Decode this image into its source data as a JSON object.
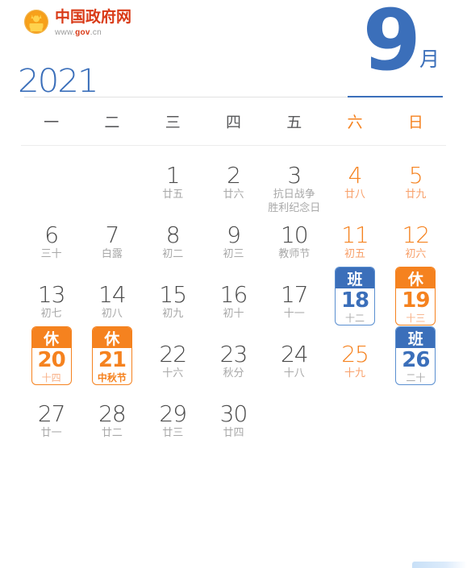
{
  "brand": {
    "emblem_icon": "national-emblem-icon",
    "site_name": "中国政府网",
    "url_prefix": "www.",
    "url_mid": "gov",
    "url_suffix": ".cn"
  },
  "header": {
    "year": "2021",
    "month_number": "9",
    "month_unit": "月",
    "accent_color": "#3b6fba",
    "weekend_color": "#f5821f"
  },
  "weekdays": [
    {
      "label": "一",
      "weekend": false
    },
    {
      "label": "二",
      "weekend": false
    },
    {
      "label": "三",
      "weekend": false
    },
    {
      "label": "四",
      "weekend": false
    },
    {
      "label": "五",
      "weekend": false
    },
    {
      "label": "六",
      "weekend": true
    },
    {
      "label": "日",
      "weekend": true
    }
  ],
  "calendar": {
    "leading_blanks": 2,
    "days": [
      {
        "day": "1",
        "lunar": "廿五",
        "weekend": false,
        "mark": null
      },
      {
        "day": "2",
        "lunar": "廿六",
        "weekend": false,
        "mark": null
      },
      {
        "day": "3",
        "lunar": "抗日战争\n胜利纪念日",
        "weekend": false,
        "mark": null
      },
      {
        "day": "4",
        "lunar": "廿八",
        "weekend": true,
        "mark": null
      },
      {
        "day": "5",
        "lunar": "廿九",
        "weekend": true,
        "mark": null
      },
      {
        "day": "6",
        "lunar": "三十",
        "weekend": false,
        "mark": null
      },
      {
        "day": "7",
        "lunar": "白露",
        "weekend": false,
        "mark": null
      },
      {
        "day": "8",
        "lunar": "初二",
        "weekend": false,
        "mark": null
      },
      {
        "day": "9",
        "lunar": "初三",
        "weekend": false,
        "mark": null
      },
      {
        "day": "10",
        "lunar": "教师节",
        "weekend": false,
        "mark": null
      },
      {
        "day": "11",
        "lunar": "初五",
        "weekend": true,
        "mark": null
      },
      {
        "day": "12",
        "lunar": "初六",
        "weekend": true,
        "mark": null
      },
      {
        "day": "13",
        "lunar": "初七",
        "weekend": false,
        "mark": null
      },
      {
        "day": "14",
        "lunar": "初八",
        "weekend": false,
        "mark": null
      },
      {
        "day": "15",
        "lunar": "初九",
        "weekend": false,
        "mark": null
      },
      {
        "day": "16",
        "lunar": "初十",
        "weekend": false,
        "mark": null
      },
      {
        "day": "17",
        "lunar": "十一",
        "weekend": false,
        "mark": null
      },
      {
        "day": "18",
        "lunar": "十二",
        "weekend": true,
        "mark": "work",
        "mark_label": "班"
      },
      {
        "day": "19",
        "lunar": "十三",
        "weekend": true,
        "mark": "rest",
        "mark_label": "休"
      },
      {
        "day": "20",
        "lunar": "十四",
        "weekend": false,
        "mark": "rest",
        "mark_label": "休"
      },
      {
        "day": "21",
        "lunar": "中秋节",
        "weekend": false,
        "mark": "rest",
        "mark_label": "休",
        "festival": true
      },
      {
        "day": "22",
        "lunar": "十六",
        "weekend": false,
        "mark": null
      },
      {
        "day": "23",
        "lunar": "秋分",
        "weekend": false,
        "mark": null
      },
      {
        "day": "24",
        "lunar": "十八",
        "weekend": false,
        "mark": null
      },
      {
        "day": "25",
        "lunar": "十九",
        "weekend": true,
        "mark": null
      },
      {
        "day": "26",
        "lunar": "二十",
        "weekend": true,
        "mark": "work",
        "mark_label": "班"
      },
      {
        "day": "27",
        "lunar": "廿一",
        "weekend": false,
        "mark": null
      },
      {
        "day": "28",
        "lunar": "廿二",
        "weekend": false,
        "mark": null
      },
      {
        "day": "29",
        "lunar": "廿三",
        "weekend": false,
        "mark": null
      },
      {
        "day": "30",
        "lunar": "廿四",
        "weekend": false,
        "mark": null
      }
    ]
  }
}
